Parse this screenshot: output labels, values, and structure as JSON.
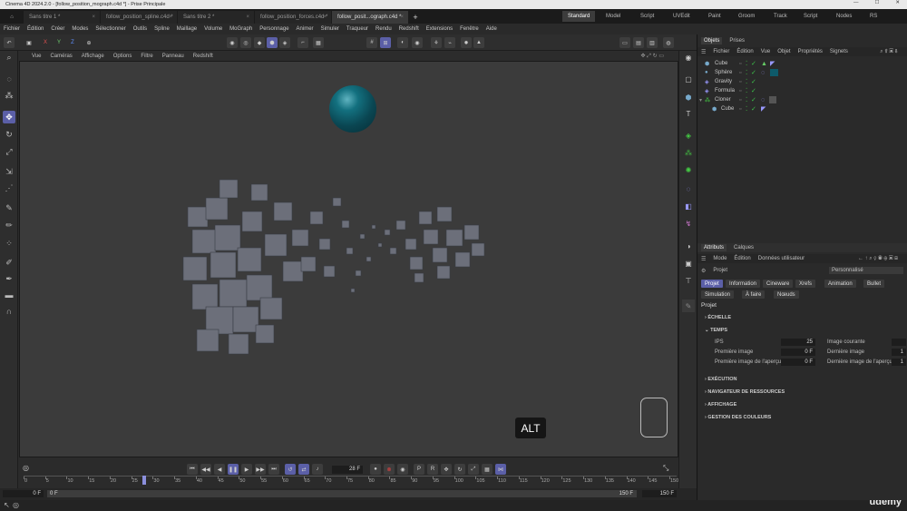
{
  "window": {
    "title": "Cinema 4D 2024.2.0 - [follow_position_mograph.c4d *] - Prise Principale"
  },
  "doc_tabs": [
    {
      "label": "Sans titre 1 *"
    },
    {
      "label": "follow_position_spline.c4d *"
    },
    {
      "label": "Sans titre 2 *"
    },
    {
      "label": "follow_position_forces.c4d *"
    },
    {
      "label": "follow_posit...ograph.c4d *"
    }
  ],
  "layouts": [
    "Standard",
    "Model",
    "Script",
    "UVEdit",
    "Paint",
    "Groom",
    "Track",
    "Script",
    "Nodes",
    "RS"
  ],
  "main_menu": [
    "Fichier",
    "Édition",
    "Créer",
    "Modes",
    "Sélectionner",
    "Outils",
    "Spline",
    "Maillage",
    "Volume",
    "MoGraph",
    "Personnage",
    "Animer",
    "Simuler",
    "Traqueur",
    "Rendu",
    "Redshift",
    "Extensions",
    "Fenêtre",
    "Aide"
  ],
  "axis_buttons": [
    "X",
    "Y",
    "Z"
  ],
  "view_menu": [
    "Vue",
    "Caméras",
    "Affichage",
    "Options",
    "Filtre",
    "Panneau",
    "Redshift"
  ],
  "viewport": {
    "overlay_key": "ALT"
  },
  "timeline": {
    "current_frame": "28 F",
    "current_frame_marker": 28,
    "ruler_labels": [
      "0",
      "5",
      "10",
      "15",
      "20",
      "25",
      "30",
      "35",
      "40",
      "45",
      "50",
      "55",
      "60",
      "65",
      "70",
      "75",
      "80",
      "85",
      "90",
      "95",
      "100",
      "105",
      "110",
      "115",
      "120",
      "125",
      "130",
      "135",
      "140",
      "145",
      "150"
    ],
    "start_field": "0 F",
    "start_field_2": "0 F",
    "end_field": "150 F",
    "end_field_2": "150 F"
  },
  "objects_panel": {
    "tabs": [
      "Objets",
      "Prises"
    ],
    "menu": [
      "Fichier",
      "Édition",
      "Vue",
      "Objet",
      "Propriétés",
      "Signets"
    ],
    "items": [
      {
        "name": "Cube"
      },
      {
        "name": "Sphère"
      },
      {
        "name": "Gravity"
      },
      {
        "name": "Formula"
      },
      {
        "name": "Cloner"
      },
      {
        "name": "Cube"
      }
    ]
  },
  "attributes_panel": {
    "tabs": [
      "Attributs",
      "Calques"
    ],
    "menu": [
      "Mode",
      "Édition",
      "Données utilisateur"
    ],
    "context_label": "Projet",
    "preset_select": "Personnalisé",
    "subtabs_row1": [
      "Projet",
      "Information",
      "Cineware",
      "Xrefs",
      "Animation",
      "Bullet"
    ],
    "subtabs_row2": [
      "Simulation",
      "À faire",
      "Nœuds"
    ],
    "section_title": "Projet",
    "groups": {
      "echelle": "ÉCHELLE",
      "temps": "TEMPS",
      "execution": "EXÉCUTION",
      "navigateur": "NAVIGATEUR DE RESSOURCES",
      "affichage": "AFFICHAGE",
      "couleurs": "GESTION DES COULEURS"
    },
    "fields": {
      "ips_label": "IPS",
      "ips_value": "25",
      "image_courante_label": "Image courante",
      "premiere_image_label": "Première image",
      "premiere_image_value": "0 F",
      "derniere_image_label": "Dernière image",
      "derniere_image_value": "1",
      "premiere_apercu_label": "Première image de l'aperçu",
      "premiere_apercu_value": "0 F",
      "derniere_apercu_label": "Dernière image de l'aperçu",
      "derniere_apercu_value": "1"
    }
  },
  "watermark": "ûdemy",
  "colors": {
    "accent": "#5b5fa7",
    "check_green": "#3cc24a",
    "sphere": "#0e5a6a"
  }
}
